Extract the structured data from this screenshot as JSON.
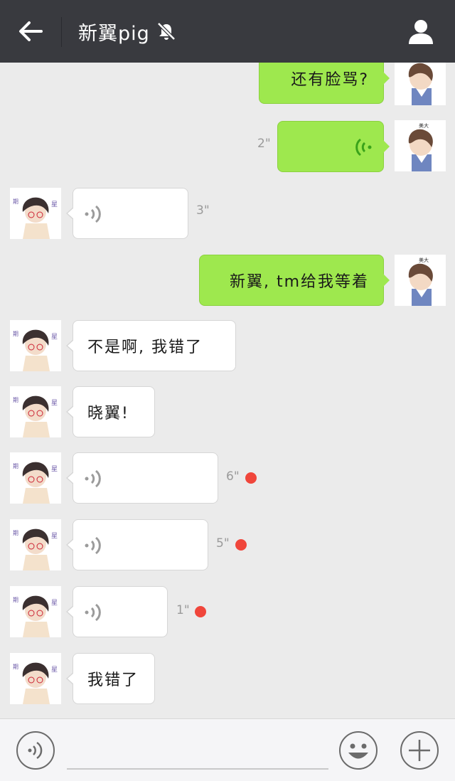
{
  "header": {
    "title": "新翼pig",
    "back_icon": "arrow-left-icon",
    "mute_icon": "bell-slash-icon",
    "profile_icon": "person-icon",
    "bar_color": "#393a3f"
  },
  "messages": [
    {
      "direction": "out",
      "type": "text",
      "text": "还有脸骂?"
    },
    {
      "direction": "out",
      "type": "voice",
      "duration": "2\""
    },
    {
      "direction": "in",
      "type": "voice",
      "duration": "3\""
    },
    {
      "direction": "out",
      "type": "text",
      "text": "新翼, tm给我等着"
    },
    {
      "direction": "in",
      "type": "text",
      "text": "不是啊, 我错了"
    },
    {
      "direction": "in",
      "type": "text",
      "text": "晓翼!"
    },
    {
      "direction": "in",
      "type": "voice",
      "duration": "6\"",
      "unread": true
    },
    {
      "direction": "in",
      "type": "voice",
      "duration": "5\"",
      "unread": true
    },
    {
      "direction": "in",
      "type": "voice",
      "duration": "1\"",
      "unread": true
    },
    {
      "direction": "in",
      "type": "text",
      "text": "我错了"
    }
  ],
  "avatars": {
    "self_label": "美大",
    "other_label": "星"
  },
  "footer": {
    "voice_toggle_icon": "voice-mode-icon",
    "emoji_icon": "smiley-icon",
    "add_icon": "plus-icon",
    "input_value": ""
  },
  "colors": {
    "outgoing_bubble": "#9ee84e",
    "incoming_bubble": "#ffffff",
    "unread_dot": "#f0463b",
    "background": "#ebebeb"
  }
}
